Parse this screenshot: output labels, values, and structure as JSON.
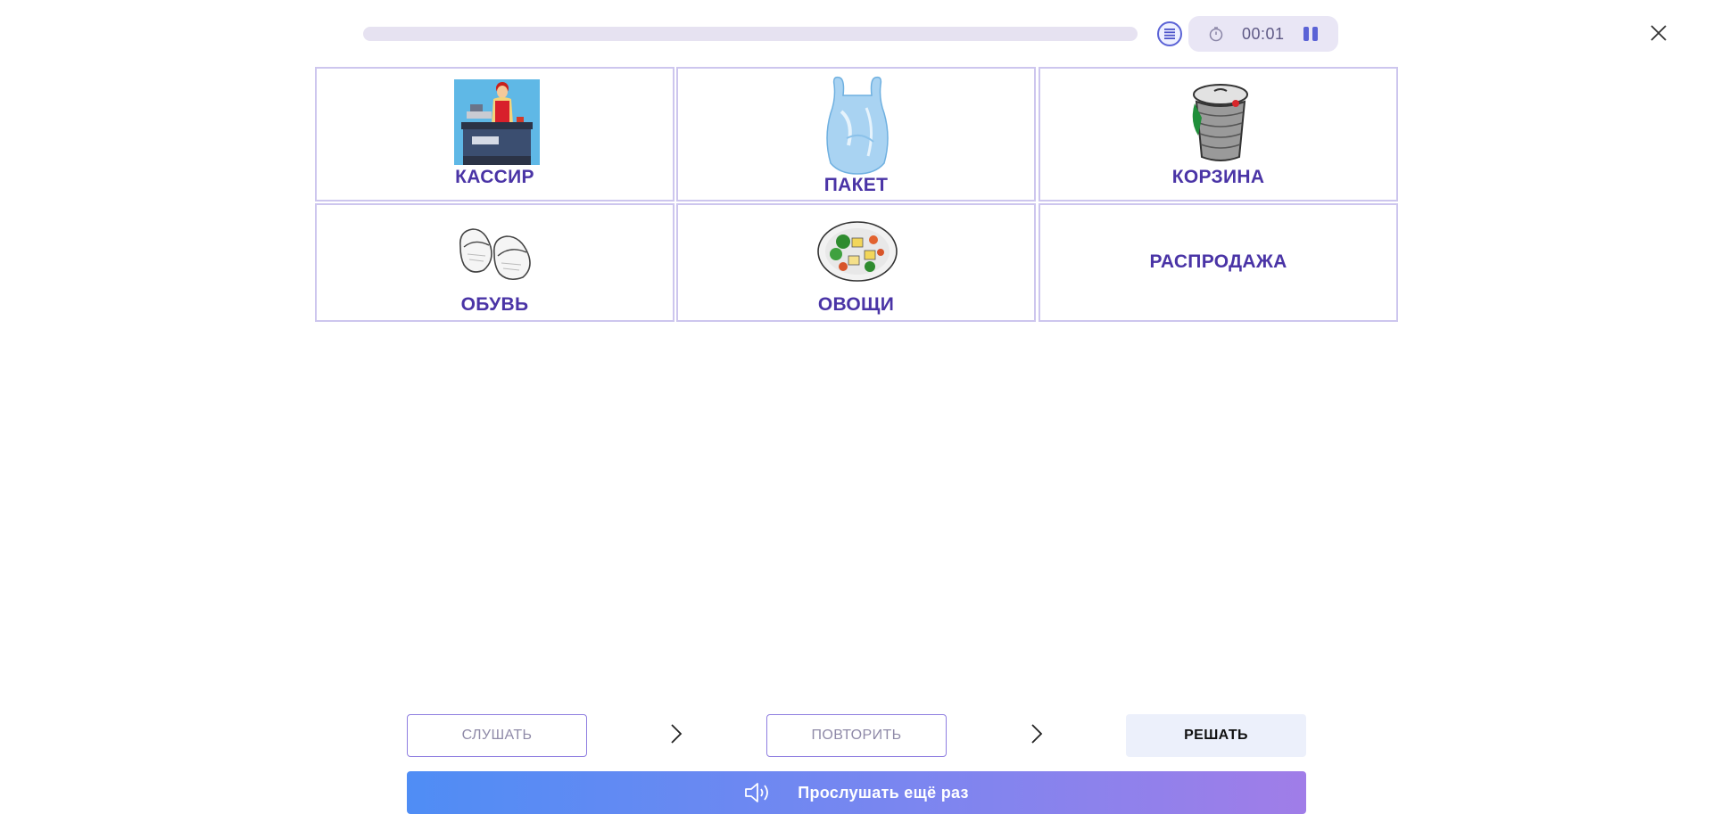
{
  "header": {
    "progress_fraction": 0,
    "timer": "00:01",
    "icons": {
      "list": "list-icon",
      "clock": "clock-icon",
      "pause": "pause-icon",
      "close": "close-icon"
    }
  },
  "cards": [
    {
      "label": "КАССИР",
      "image": "cashier-image"
    },
    {
      "label": "ПАКЕТ",
      "image": "plastic-bag-image"
    },
    {
      "label": "КОРЗИНА",
      "image": "basket-image"
    },
    {
      "label": "ОБУВЬ",
      "image": "slippers-image"
    },
    {
      "label": "ОВОЩИ",
      "image": "vegetables-image"
    },
    {
      "label": "РАСПРОДАЖА",
      "image": ""
    }
  ],
  "steps": [
    {
      "label": "СЛУШАТЬ"
    },
    {
      "label": "ПОВТОРИТЬ"
    },
    {
      "label": "РЕШАТЬ"
    }
  ],
  "listen_again": {
    "label": "Прослушать ещё раз",
    "icon": "speaker-icon"
  },
  "colors": {
    "accent": "#4a34a6",
    "card_border": "#cdc6ee",
    "gradient_start": "#4f8df5",
    "gradient_end": "#a07de8"
  }
}
